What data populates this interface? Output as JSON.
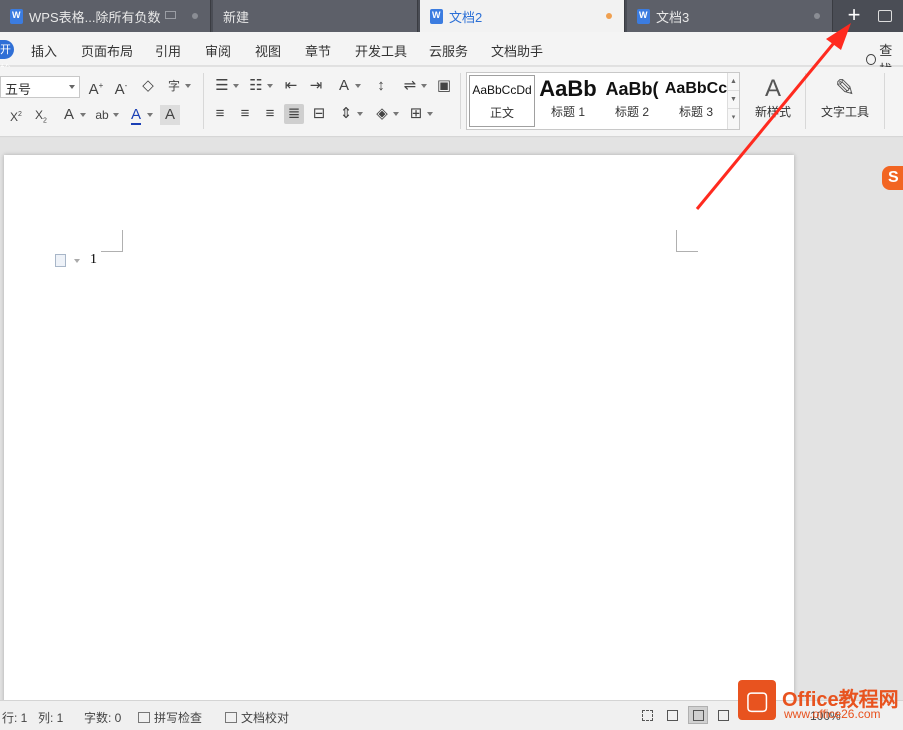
{
  "tabs": [
    {
      "label": "WPS表格...除所有负数",
      "active": false
    },
    {
      "label": "新建",
      "active": false
    },
    {
      "label": "文档2",
      "active": true
    },
    {
      "label": "文档3",
      "active": false
    }
  ],
  "tab_new_symbol": "+",
  "menu": {
    "start_label": "开始",
    "items": [
      "插入",
      "页面布局",
      "引用",
      "审阅",
      "视图",
      "章节",
      "开发工具",
      "云服务",
      "文档助手"
    ],
    "search_label": "查找"
  },
  "ribbon": {
    "font_size": "五号",
    "styles": [
      {
        "sample": "AaBbCcDd",
        "name": "正文"
      },
      {
        "sample": "AaBb",
        "name": "标题 1"
      },
      {
        "sample": "AaBb(",
        "name": "标题 2"
      },
      {
        "sample": "AaBbCc",
        "name": "标题 3"
      }
    ],
    "new_style_label": "新样式",
    "text_tools_label": "文字工具"
  },
  "document": {
    "text": "1"
  },
  "sogou_glyph": "S",
  "status": {
    "row": "行: 1",
    "col": "列: 1",
    "word_count": "字数: 0",
    "spell_check": "拼写检查",
    "doc_proof": "文档校对",
    "zoom": "100%"
  },
  "watermark": {
    "title": "Office教程网",
    "url": "www.office26.com"
  },
  "colors": {
    "tab_bar": "#4a4d55",
    "accent_blue": "#2f6fd6",
    "annotation_red": "#ff2a1f",
    "watermark_orange": "#e8531f"
  }
}
